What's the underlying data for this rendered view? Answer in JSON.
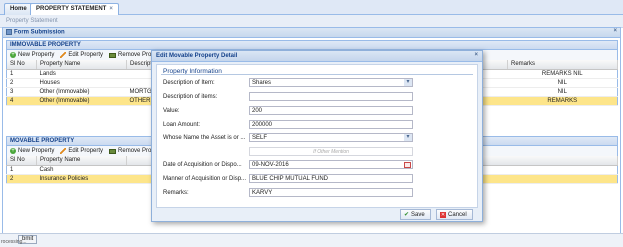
{
  "tabs": [
    {
      "label": "Home"
    },
    {
      "label": "PROPERTY STATEMENT",
      "close": "×"
    }
  ],
  "background_strip": "Property Statement",
  "window": {
    "title": "Form Submission",
    "close": "×"
  },
  "immovable": {
    "title": "IMMOVABLE PROPERTY",
    "toolbar": {
      "new": "New Property",
      "edit": "Edit Property",
      "remove": "Remove Prope"
    },
    "columns": {
      "no": "Sl No",
      "name": "Property Name",
      "desc": "Descripti",
      "remarks": "Remarks"
    },
    "rows": [
      {
        "no": "1",
        "name": "Lands",
        "desc": "",
        "remarks": "REMARKS NIL"
      },
      {
        "no": "2",
        "name": "Houses",
        "desc": "",
        "remarks": "NIL"
      },
      {
        "no": "3",
        "name": "Other (Immovable)",
        "desc": "MORTGAGE",
        "remarks": "NIL"
      },
      {
        "no": "4",
        "name": "Other (Immovable)",
        "desc": "OTHER I",
        "remarks": "REMARKS"
      }
    ]
  },
  "movable": {
    "title": "MOVABLE PROPERTY",
    "toolbar": {
      "new": "New Property",
      "edit": "Edit Property",
      "remove": "Remove Prope"
    },
    "columns": {
      "no": "Sl No",
      "name": "Property Name"
    },
    "rows": [
      {
        "no": "1",
        "name": "Cash"
      },
      {
        "no": "2",
        "name": "Insurance Policies"
      }
    ]
  },
  "footer": {
    "submit": "bmit",
    "progress": "rocessing..."
  },
  "modal": {
    "title": "Edit Movable Property Detail",
    "close": "×",
    "section": "Property Information",
    "fields": {
      "desc_item": {
        "label": "Description of Item:",
        "value": "Shares"
      },
      "desc_items": {
        "label": "Description of items:",
        "value": ""
      },
      "value": {
        "label": "Value:",
        "value": "200"
      },
      "loan": {
        "label": "Loan Amount:",
        "value": "200000"
      },
      "whose": {
        "label": "Whose Name the Asset is or ...",
        "value": "SELF"
      },
      "other_mention": {
        "placeholder": "If Other Mention"
      },
      "date": {
        "label": "Date of Acquisition or Dispo...",
        "value": "09-NOV-2016"
      },
      "manner": {
        "label": "Manner of Acquisition or Disp...",
        "value": "BLUE CHIP MUTUAL FUND"
      },
      "remarks": {
        "label": "Remarks:",
        "value": "KARVY"
      }
    },
    "buttons": {
      "save": "Save",
      "cancel": "Cancel"
    }
  }
}
